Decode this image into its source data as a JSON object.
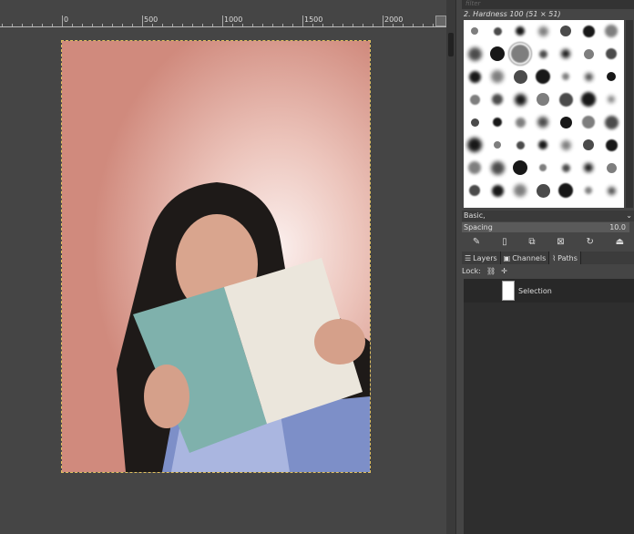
{
  "ruler": {
    "labels": [
      "0",
      "500",
      "1000",
      "1500",
      "2000"
    ]
  },
  "brushes": {
    "filter_placeholder": "filter",
    "title": "2. Hardness 100 (51 × 51)",
    "preset": "Basic,",
    "spacing_label": "Spacing",
    "spacing_value": "10.0"
  },
  "dock_tabs": [
    {
      "label": "Layers",
      "icon": "layers-icon"
    },
    {
      "label": "Channels",
      "icon": "channels-icon"
    },
    {
      "label": "Paths",
      "icon": "paths-icon",
      "active": true
    }
  ],
  "lock_label": "Lock:",
  "paths": [
    {
      "name": "Selection"
    }
  ],
  "colors": {
    "accent": "#e0c060",
    "background": "#454545"
  }
}
